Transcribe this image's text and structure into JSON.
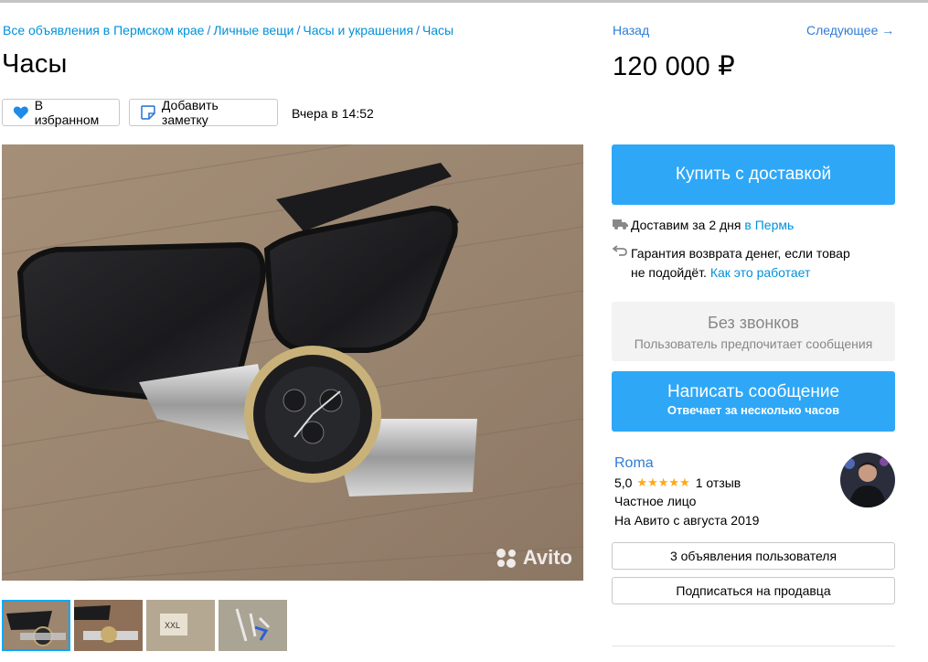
{
  "breadcrumbs": [
    "Все объявления в Пермском крае",
    "Личные вещи",
    "Часы и украшения",
    "Часы"
  ],
  "breadcrumb_separator": "/",
  "title": "Часы",
  "actions": {
    "favorite_label": "В избранном",
    "note_label": "Добавить заметку",
    "date": "Вчера в 14:52"
  },
  "nav": {
    "back": "Назад",
    "next": "Следующее →"
  },
  "price": "120 000 ₽",
  "buy_button": "Купить с доставкой",
  "delivery": {
    "text": "Доставим за 2 дня",
    "city_link": "в Пермь"
  },
  "guarantee": {
    "line1": "Гарантия возврата денег, если товар",
    "line2": "не подойдёт.",
    "link": "Как это работает"
  },
  "no_calls": {
    "title": "Без звонков",
    "subtitle": "Пользователь предпочитает сообщения"
  },
  "message_button": {
    "title": "Написать сообщение",
    "subtitle": "Отвечает за несколько часов"
  },
  "seller": {
    "name": "Roma",
    "rating": "5,0",
    "stars": "★★★★★",
    "reviews": "1 отзыв",
    "type": "Частное лицо",
    "since": "На Авито с августа 2019",
    "listings_button": "3 объявления пользователя",
    "subscribe_button": "Подписаться на продавца"
  },
  "watermark": "Avito",
  "colors": {
    "accent": "#2ea7f7",
    "link": "#2f7cd6",
    "star": "#ffa913"
  }
}
